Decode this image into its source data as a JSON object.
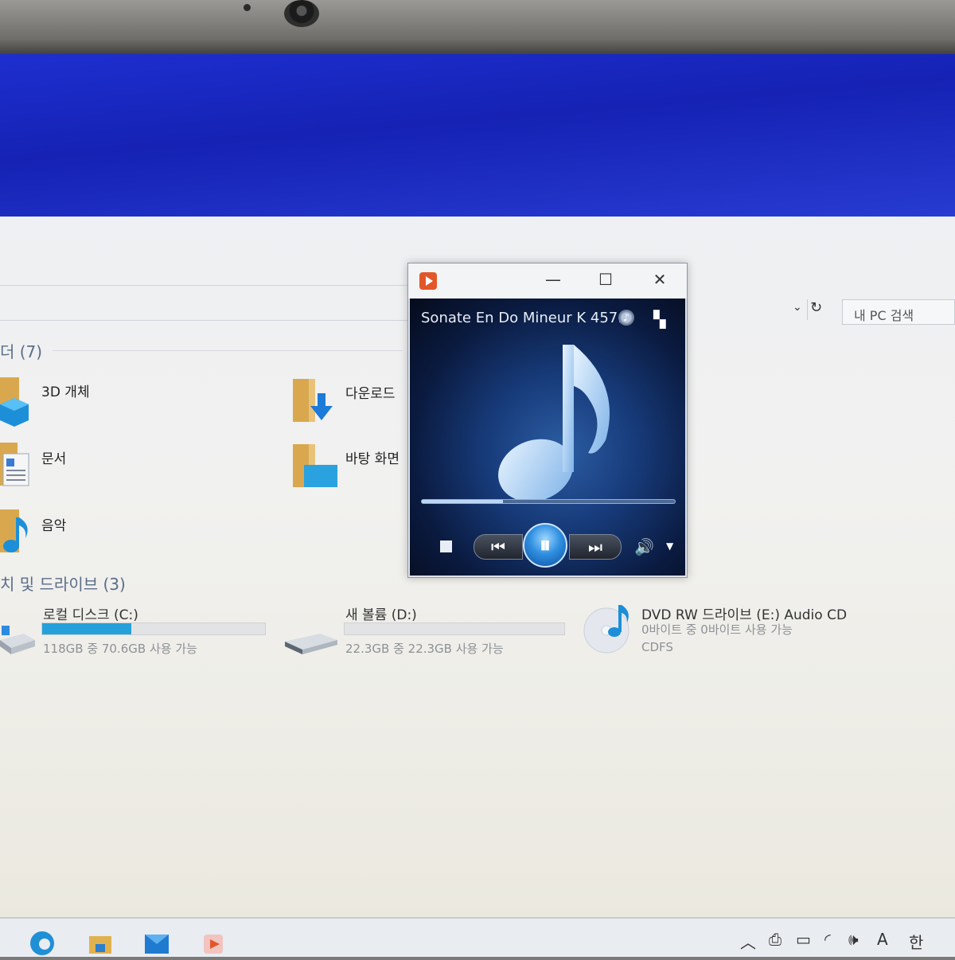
{
  "explorer": {
    "search_placeholder": "내 PC 검색",
    "folders_heading": "더 (7)",
    "folders": [
      {
        "label": "3D 개체",
        "icon": "3d-objects-icon"
      },
      {
        "label": "다운로드",
        "icon": "downloads-folder-icon"
      },
      {
        "label": "문서",
        "icon": "documents-folder-icon"
      },
      {
        "label": "바탕 화면",
        "icon": "desktop-folder-icon"
      },
      {
        "label": "음악",
        "icon": "music-folder-icon"
      }
    ],
    "drives_heading": "치 및 드라이브 (3)",
    "drives": [
      {
        "name": "로컬 디스크 (C:)",
        "info": "118GB 중 70.6GB 사용 가능",
        "used_fraction": 0.4
      },
      {
        "name": "새 볼륨 (D:)",
        "info": "22.3GB 중 22.3GB 사용 가능",
        "used_fraction": 0.0
      },
      {
        "name": "DVD RW 드라이브 (E:) Audio CD",
        "info": "0바이트 중 0바이트 사용 가능",
        "fs": "CDFS"
      }
    ]
  },
  "player": {
    "now_playing": "Sonate En Do Mineur K 457...",
    "seek_fraction": 0.32,
    "controls": {
      "stop": "stop-icon",
      "prev": "⏮",
      "pause": "⏸",
      "next": "⏭",
      "volume": "🔊",
      "volume_menu": "▼"
    },
    "window_buttons": {
      "minimize": "—",
      "maximize": "☐",
      "close": "✕"
    }
  },
  "tray": {
    "up_arrow": "︿",
    "ime_mode": "A",
    "ime_lang": "한"
  },
  "colors": {
    "wallpaper": "#1a2ac4",
    "drive_bar": "#26a0da",
    "section_heading": "#5a6d89"
  }
}
